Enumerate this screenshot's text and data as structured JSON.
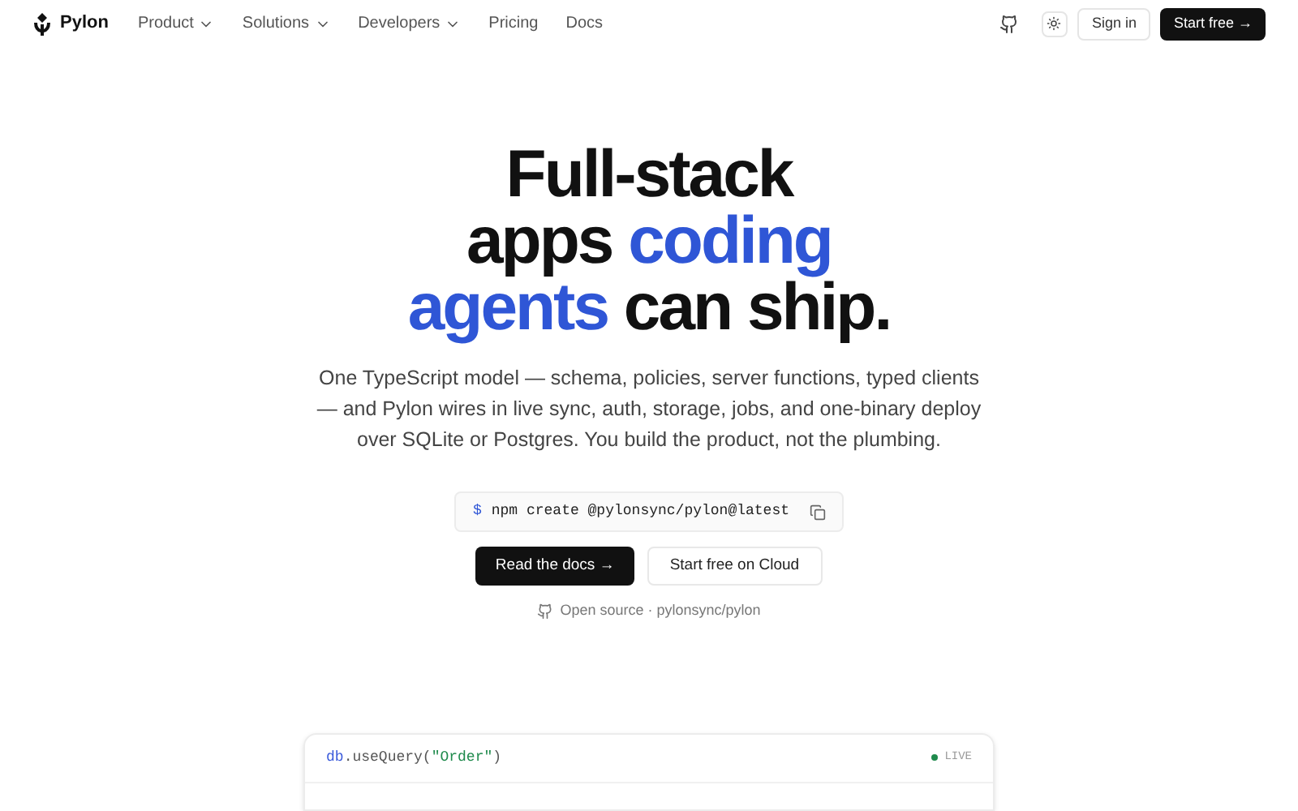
{
  "nav": {
    "brand": "Pylon",
    "items": [
      {
        "label": "Product",
        "dropdown": true
      },
      {
        "label": "Solutions",
        "dropdown": true
      },
      {
        "label": "Developers",
        "dropdown": true
      },
      {
        "label": "Pricing",
        "dropdown": false
      },
      {
        "label": "Docs",
        "dropdown": false
      }
    ],
    "sign_in": "Sign in",
    "start": "Start free →"
  },
  "hero": {
    "heading": [
      [
        {
          "text": "Full-stack",
          "accent": false
        }
      ],
      [
        {
          "text": "apps ",
          "accent": false
        },
        {
          "text": "coding",
          "accent": true
        }
      ],
      [
        {
          "text": "agents",
          "accent": true
        },
        {
          "text": " can ship.",
          "accent": false
        }
      ]
    ],
    "description": "One TypeScript model — schema, policies, server functions, typed clients — and Pylon wires in live sync, auth, storage, jobs, and one-binary deploy over SQLite or Postgres. You build the product, not the plumbing.",
    "command": {
      "prompt": "$",
      "text": "npm create @pylonsync/pylon@latest"
    },
    "primary": "Read the docs →",
    "secondary": "Start free on Cloud",
    "open_source": "Open source · pylonsync/pylon"
  },
  "code_card": {
    "tokens": [
      {
        "text": "db",
        "kind": "object"
      },
      {
        "text": ".useQuery(",
        "kind": "plain"
      },
      {
        "text": "\"Order\"",
        "kind": "string"
      },
      {
        "text": ")",
        "kind": "plain"
      }
    ],
    "status": "LIVE",
    "live": true
  }
}
